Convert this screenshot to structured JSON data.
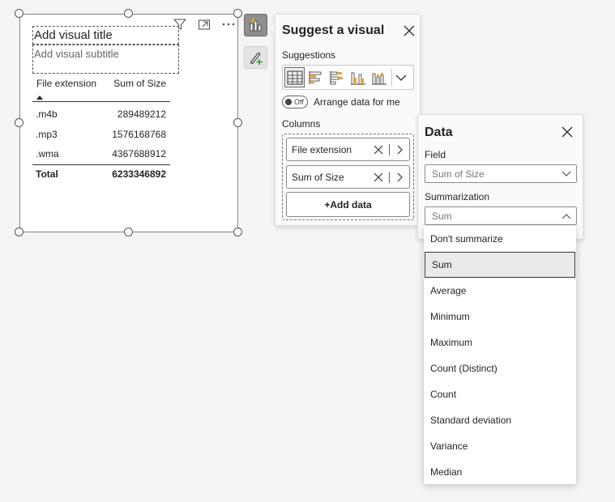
{
  "visual": {
    "title_placeholder": "Add visual title",
    "subtitle_placeholder": "Add visual subtitle",
    "toolbar_icons": [
      "filter-icon",
      "focus-mode-icon",
      "more-options-icon"
    ],
    "table": {
      "columns": [
        "File extension",
        "Sum of Size"
      ],
      "rows": [
        {
          "ext": ".m4b",
          "size": "289489212"
        },
        {
          "ext": ".mp3",
          "size": "1576168768"
        },
        {
          "ext": ".wma",
          "size": "4367688912"
        }
      ],
      "total_label": "Total",
      "total_value": "6233346892"
    }
  },
  "side_buttons": [
    "suggest-visual-icon",
    "format-visual-icon"
  ],
  "suggest_panel": {
    "title": "Suggest a visual",
    "suggestions_label": "Suggestions",
    "suggestion_icons": [
      "table-icon",
      "clustered-bar-icon",
      "stacked-bar-icon",
      "clustered-column-icon",
      "stacked-column-icon"
    ],
    "toggle_state": "Off",
    "toggle_label": "Arrange data for me",
    "columns_label": "Columns",
    "fields": [
      "File extension",
      "Sum of Size"
    ],
    "add_data_label": "+Add data"
  },
  "data_panel": {
    "title": "Data",
    "field_label": "Field",
    "field_value": "Sum of Size",
    "summarization_label": "Summarization",
    "summarization_value": "Sum",
    "options": [
      "Don't summarize",
      "Sum",
      "Average",
      "Minimum",
      "Maximum",
      "Count (Distinct)",
      "Count",
      "Standard deviation",
      "Variance",
      "Median"
    ],
    "selected_option": "Sum"
  },
  "colors": {
    "background": "#f4f4f4",
    "active_button": "#8f8f8f",
    "accent_orange": "#e8a33c",
    "accent_green": "#3a8f3a",
    "selected_option_bg": "#eaeaea"
  }
}
